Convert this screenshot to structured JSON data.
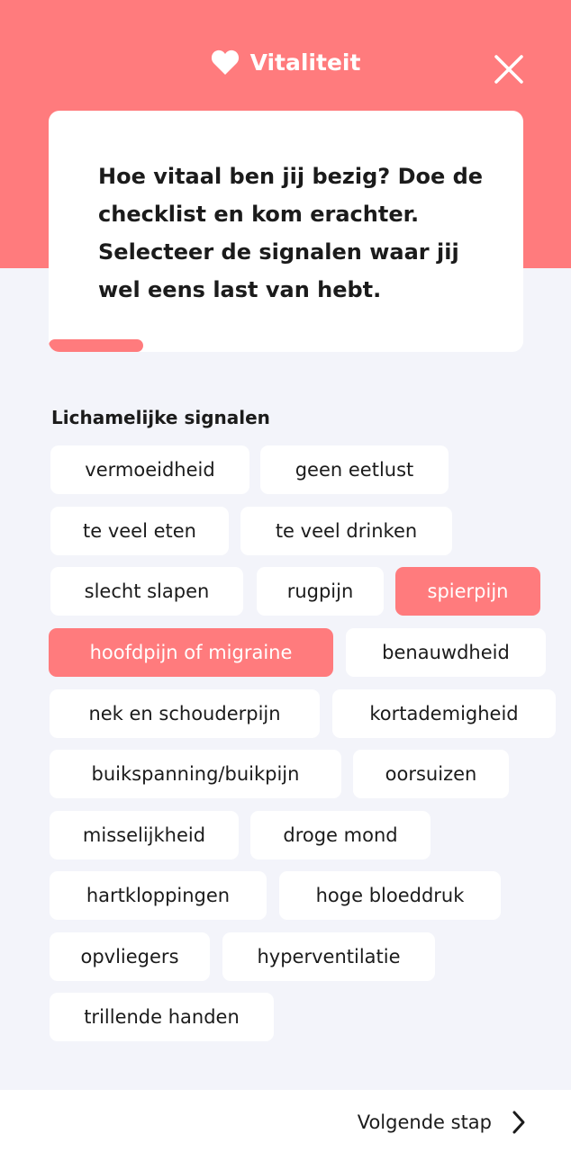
{
  "header": {
    "title": "Vitaliteit",
    "icon": "heart-icon",
    "close_icon": "close-icon",
    "background_color": "#ff7b7d"
  },
  "intro": {
    "text": "Hoe vitaal ben jij bezig? Doe de checklist en kom erachter. Selecteer de signalen waar jij wel eens last van hebt.",
    "progress_fraction": 0.2
  },
  "section": {
    "title": "Lichamelijke signalen"
  },
  "chips": [
    {
      "label": "vermoeidheid",
      "selected": false
    },
    {
      "label": "geen eetlust",
      "selected": false
    },
    {
      "label": "te veel eten",
      "selected": false
    },
    {
      "label": "te veel drinken",
      "selected": false
    },
    {
      "label": "slecht slapen",
      "selected": false
    },
    {
      "label": "rugpijn",
      "selected": false
    },
    {
      "label": "spierpijn",
      "selected": true
    },
    {
      "label": "hoofdpijn of migraine",
      "selected": true
    },
    {
      "label": "benauwdheid",
      "selected": false
    },
    {
      "label": "nek en schouderpijn",
      "selected": false
    },
    {
      "label": "kortademigheid",
      "selected": false
    },
    {
      "label": "buikspanning/buikpijn",
      "selected": false
    },
    {
      "label": "oorsuizen",
      "selected": false
    },
    {
      "label": "misselijkheid",
      "selected": false
    },
    {
      "label": "droge mond",
      "selected": false
    },
    {
      "label": "hartkloppingen",
      "selected": false
    },
    {
      "label": "hoge bloeddruk",
      "selected": false
    },
    {
      "label": "opvliegers",
      "selected": false
    },
    {
      "label": "hyperventilatie",
      "selected": false
    },
    {
      "label": "trillende handen",
      "selected": false
    }
  ],
  "footer": {
    "next_label": "Volgende stap",
    "next_icon": "chevron-right-icon"
  },
  "colors": {
    "accent": "#ff7b7d",
    "background": "#f3f4fa",
    "card": "#ffffff"
  }
}
